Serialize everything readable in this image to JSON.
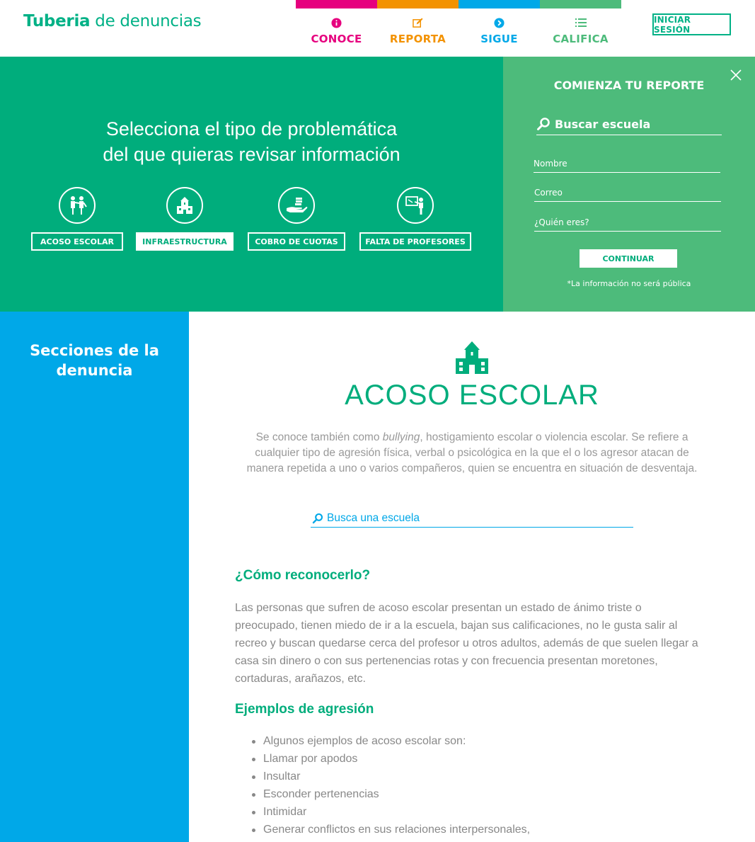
{
  "header": {
    "logo_bold": "Tuberia",
    "logo_light": "de denuncias",
    "nav": [
      {
        "label": "CONOCE",
        "icon": "info-icon",
        "color": "#e6007e"
      },
      {
        "label": "REPORTA",
        "icon": "edit-icon",
        "color": "#f39200"
      },
      {
        "label": "SIGUE",
        "icon": "chevron-right-circle-icon",
        "color": "#00a8e8"
      },
      {
        "label": "CALIFICA",
        "icon": "list-icon",
        "color": "#4dbb7b"
      }
    ],
    "login_label": "INICIAR SESIÓN"
  },
  "hero": {
    "title_line1": "Selecciona el tipo de problemática",
    "title_line2": "del que quieras revisar información",
    "categories": [
      {
        "label": "ACOSO ESCOLAR",
        "icon": "bullying-icon",
        "active": false
      },
      {
        "label": "INFRAESTRUCTURA",
        "icon": "school-icon",
        "active": true
      },
      {
        "label": "COBRO DE CUOTAS",
        "icon": "money-hand-icon",
        "active": false
      },
      {
        "label": "FALTA DE PROFESORES",
        "icon": "teacher-board-icon",
        "active": false
      }
    ]
  },
  "report": {
    "title": "COMIENZA TU REPORTE",
    "search_placeholder": "Buscar escuela",
    "name_placeholder": "Nombre",
    "email_placeholder": "Correo",
    "who_placeholder": "¿Quién eres?",
    "continue_label": "CONTINUAR",
    "note": "*La información no será pública"
  },
  "sidebar": {
    "title_line1": "Secciones de la",
    "title_line2": "denuncia"
  },
  "main": {
    "title": "ACOSO ESCOLAR",
    "intro_before": "Se conoce también como ",
    "intro_em": "bullying",
    "intro_after": ", hostigamiento escolar o violencia escolar. Se refiere a cualquier tipo de agresión física, verbal o psicológica en la que el o los agresor atacan de manera repetida a uno o varios compañeros, quien se encuentra en situación de desventaja.",
    "search_placeholder": "Busca una escuela",
    "section1_title": "¿Cómo reconocerlo?",
    "section1_text": "Las personas que sufren de acoso escolar presentan un estado de ánimo triste o preocupado, tienen miedo de ir a la escuela, bajan sus calificaciones, no le gusta salir al recreo y buscan quedarse cerca del profesor u otros adultos, además de que suelen llegar a casa sin dinero o con sus pertenencias rotas y con frecuencia presentan moretones, cortaduras, arañazos, etc.",
    "section2_title": "Ejemplos de agresión",
    "examples": [
      "Algunos ejemplos de acoso escolar son:",
      "Llamar por apodos",
      "Insultar",
      "Esconder pertenencias",
      "Intimidar",
      "Generar conflictos en sus relaciones interpersonales,"
    ]
  },
  "colors": {
    "green": "#00ad7c",
    "light_green": "#4dbb7b",
    "blue": "#00a8e8",
    "magenta": "#e6007e",
    "orange": "#f39200"
  }
}
